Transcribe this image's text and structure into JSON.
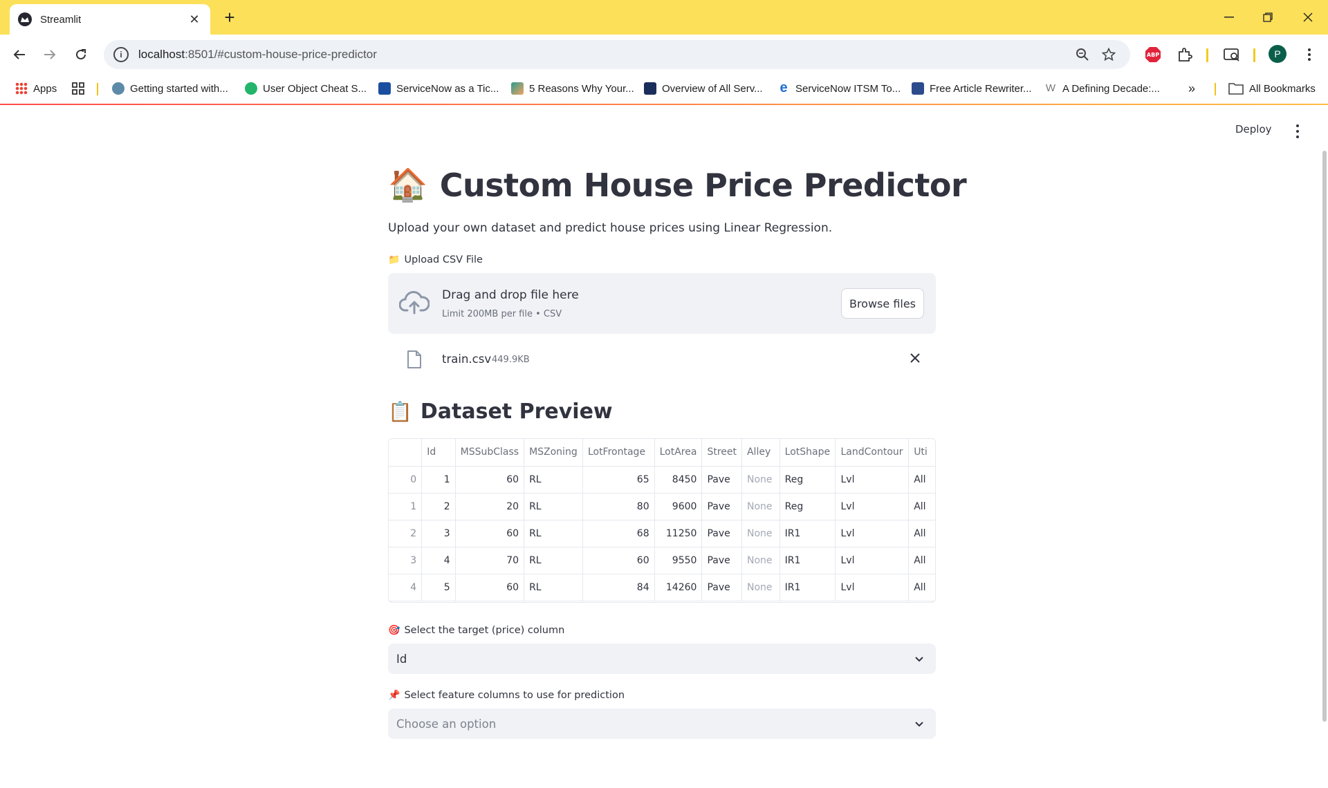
{
  "browser": {
    "tab_title": "Streamlit",
    "url_host": "localhost",
    "url_rest": ":8501/#custom-house-price-predictor",
    "bookmarks": [
      "Apps",
      "Getting started with...",
      "User Object Cheat S...",
      "ServiceNow as a Tic...",
      "5 Reasons Why Your...",
      "Overview of All Serv...",
      "ServiceNow ITSM To...",
      "Free Article Rewriter...",
      "A Defining Decade:...",
      "All Bookmarks"
    ],
    "more_bookmarks": "»",
    "profile_initial": "P"
  },
  "app": {
    "deploy_label": "Deploy",
    "title_emoji": "🏠",
    "title": "Custom House Price Predictor",
    "subtitle": "Upload your own dataset and predict house prices using Linear Regression.",
    "upload": {
      "label_emoji": "📁",
      "label": "Upload CSV File",
      "drop_text": "Drag and drop file here",
      "limit_text": "Limit 200MB per file • CSV",
      "browse_label": "Browse files",
      "file_name": "train.csv",
      "file_size": "449.9KB"
    },
    "preview": {
      "heading_emoji": "📋",
      "heading": "Dataset Preview",
      "columns": [
        "",
        "Id",
        "MSSubClass",
        "MSZoning",
        "LotFrontage",
        "LotArea",
        "Street",
        "Alley",
        "LotShape",
        "LandContour",
        "Uti"
      ],
      "rows": [
        [
          "0",
          "1",
          "60",
          "RL",
          "65",
          "8450",
          "Pave",
          "None",
          "Reg",
          "Lvl",
          "All"
        ],
        [
          "1",
          "2",
          "20",
          "RL",
          "80",
          "9600",
          "Pave",
          "None",
          "Reg",
          "Lvl",
          "All"
        ],
        [
          "2",
          "3",
          "60",
          "RL",
          "68",
          "11250",
          "Pave",
          "None",
          "IR1",
          "Lvl",
          "All"
        ],
        [
          "3",
          "4",
          "70",
          "RL",
          "60",
          "9550",
          "Pave",
          "None",
          "IR1",
          "Lvl",
          "All"
        ],
        [
          "4",
          "5",
          "60",
          "RL",
          "84",
          "14260",
          "Pave",
          "None",
          "IR1",
          "Lvl",
          "All"
        ]
      ]
    },
    "target": {
      "label_emoji": "🎯",
      "label": "Select the target (price) column",
      "value": "Id"
    },
    "features": {
      "label_emoji": "📌",
      "label": "Select feature columns to use for prediction",
      "placeholder": "Choose an option"
    }
  }
}
